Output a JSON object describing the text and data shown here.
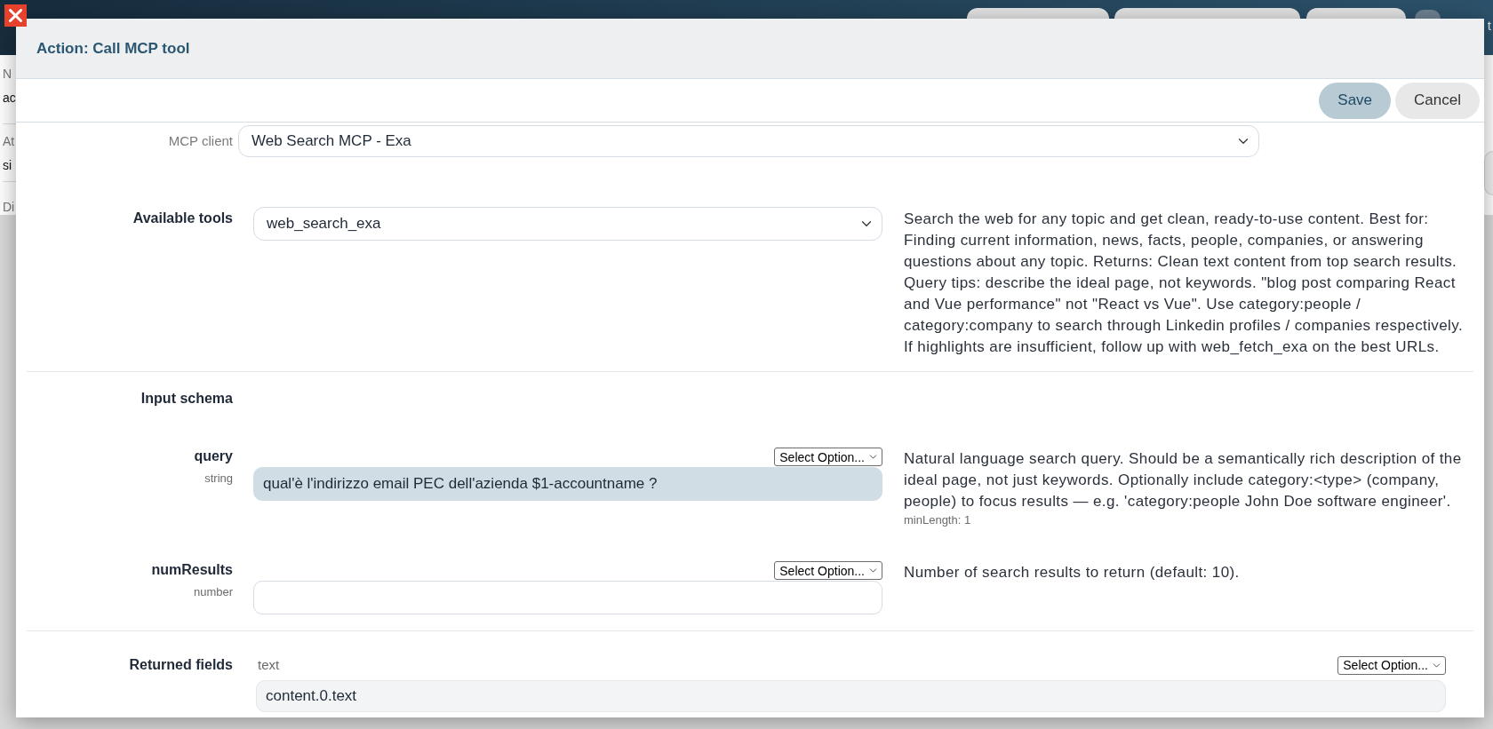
{
  "background_page": {
    "header_text": "t",
    "rows": [
      {
        "label": "N",
        "value": "ac"
      },
      {
        "label": "At",
        "value": "si"
      },
      {
        "label": "Di"
      }
    ]
  },
  "dialog": {
    "title": "Action: Call MCP tool",
    "buttons": [
      {
        "label": "Save",
        "kind": "primary"
      },
      {
        "label": "Cancel",
        "kind": "secondary"
      }
    ],
    "mcp_client": {
      "label": "MCP client",
      "value": "Web Search MCP - Exa"
    },
    "available_tools": {
      "label": "Available tools",
      "value": "web_search_exa",
      "description": "Search the web for any topic and get clean, ready-to-use content. Best for: Finding current information, news, facts, people, companies, or answering questions about any topic. Returns: Clean text content from top search results. Query tips: describe the ideal page, not keywords. \"blog post comparing React and Vue performance\" not \"React vs Vue\". Use category:people / category:company to search through Linkedin profiles / companies respectively. If highlights are insufficient, follow up with web_fetch_exa on the best URLs."
    },
    "input_schema": {
      "label": "Input schema",
      "params": [
        {
          "name": "query",
          "type": "string",
          "mode_select": "Select Option...",
          "value": "qual'è l'indirizzo email PEC dell'azienda $1-accountname ?",
          "focused": true,
          "description": "Natural language search query. Should be a semantically rich description of the ideal page, not just keywords. Optionally include category:<type> (company, people) to focus results — e.g. 'category:people John Doe software engineer'.",
          "constraint": "minLength: 1"
        },
        {
          "name": "numResults",
          "type": "number",
          "mode_select": "Select Option...",
          "focused": false,
          "description": "Number of search results to return (default: 10)."
        }
      ]
    },
    "returned_fields": {
      "label": "Returned fields",
      "fields": [
        {
          "name": "text",
          "mode_select": "Select Option...",
          "value": "content.0.text"
        }
      ]
    }
  }
}
